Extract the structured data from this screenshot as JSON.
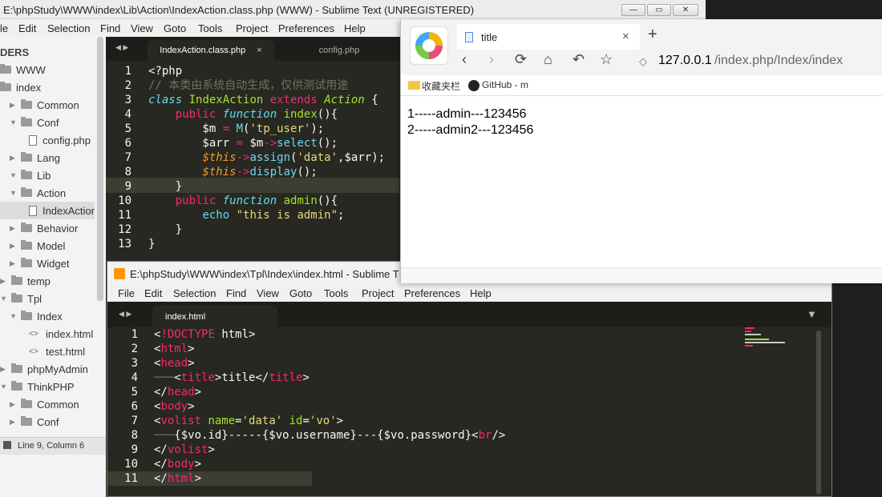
{
  "editor_back": {
    "title": "E:\\phpStudy\\WWW\\index\\Lib\\Action\\IndexAction.class.php (WWW) - Sublime Text (UNREGISTERED)",
    "menu": [
      "le",
      "Edit",
      "Selection",
      "Find",
      "View",
      "Goto",
      "Tools",
      "Project",
      "Preferences",
      "Help"
    ],
    "sidebar_header": "DERS",
    "tree": [
      "WWW",
      "index",
      "Common",
      "Conf",
      "config.php",
      "Lang",
      "Lib",
      "Action",
      "IndexActior",
      "Behavior",
      "Model",
      "Widget",
      "temp",
      "Tpl",
      "Index",
      "index.html",
      "test.html",
      "phpMyAdmin",
      "ThinkPHP",
      "Common",
      "Conf"
    ],
    "status": "Line 9, Column 6",
    "tabs": [
      "IndexAction.class.php",
      "config.php"
    ],
    "tab_close": "×",
    "line_numbers": [
      "1",
      "2",
      "3",
      "4",
      "5",
      "6",
      "7",
      "8",
      "9",
      "10",
      "11",
      "12",
      "13"
    ]
  },
  "editor_front": {
    "title": "E:\\phpStudy\\WWW\\index\\Tpl\\Index\\index.html - Sublime T",
    "menu": [
      "File",
      "Edit",
      "Selection",
      "Find",
      "View",
      "Goto",
      "Tools",
      "Project",
      "Preferences",
      "Help"
    ],
    "tab": "index.html",
    "line_numbers": [
      "1",
      "2",
      "3",
      "4",
      "5",
      "6",
      "7",
      "8",
      "9",
      "10",
      "11"
    ]
  },
  "browser": {
    "tab_title": "title",
    "tab_close": "×",
    "new_tab": "+",
    "url_host": "127.0.0.1",
    "url_path": "/index.php/Index/index",
    "bookmarks": [
      "收藏夹栏",
      "GitHub - m"
    ],
    "rows": [
      "1-----admin---123456",
      "2-----admin2---123456"
    ]
  },
  "colors": {
    "editor_bg": "#272822",
    "keyword": "#66d9ef",
    "tag": "#f92672",
    "function": "#a6e22e",
    "string": "#e6db74"
  }
}
